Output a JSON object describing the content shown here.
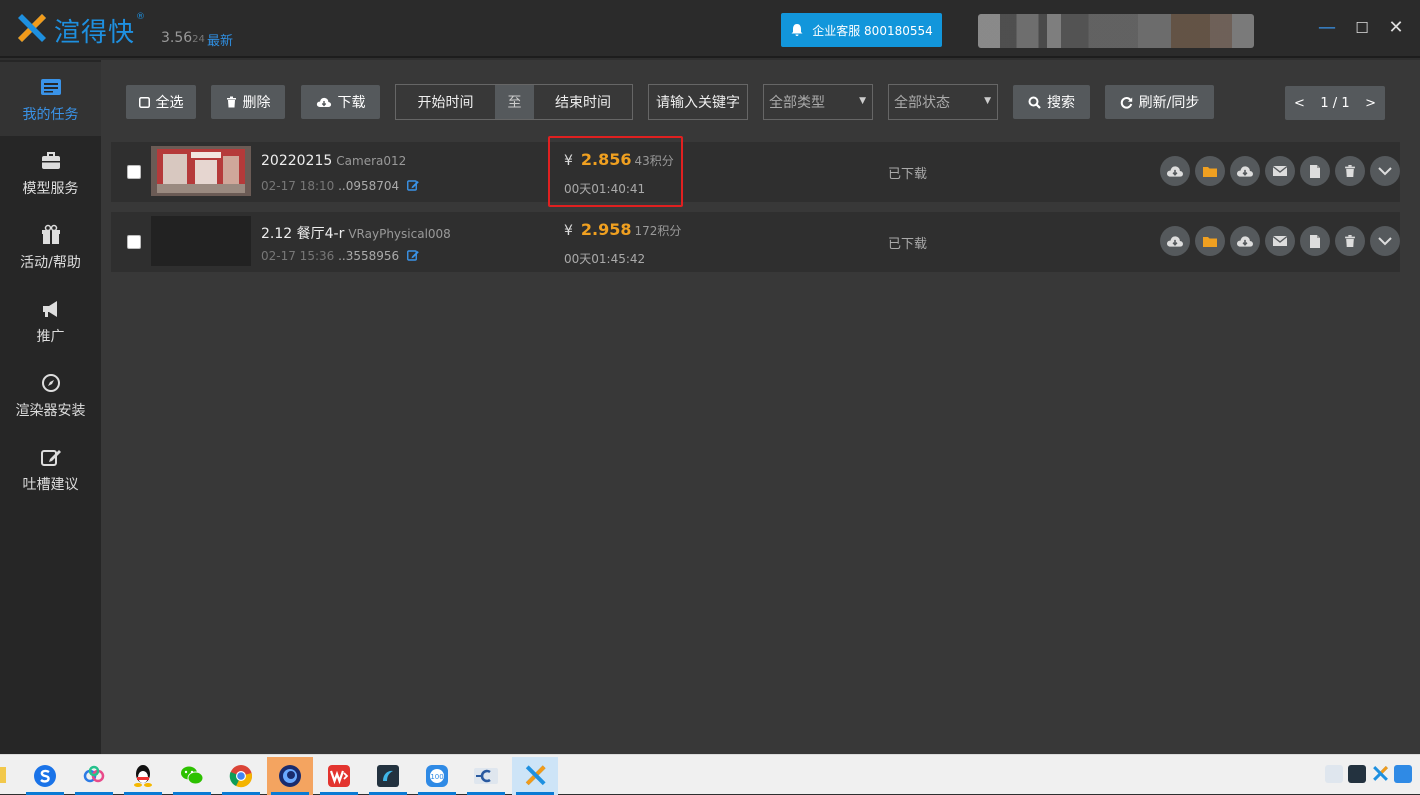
{
  "app": {
    "name": "渲得快",
    "registered": "®",
    "version": "3.56",
    "build": "24",
    "latest": "最新",
    "support_button": "企业客服 800180554",
    "window_minimize": "—",
    "window_maximize": "☐",
    "window_close": "✕"
  },
  "sidebar": {
    "items": [
      {
        "label": "我的任务",
        "icon": "task-list-icon",
        "active": true
      },
      {
        "label": "模型服务",
        "icon": "briefcase-icon"
      },
      {
        "label": "活动/帮助",
        "icon": "gift-icon"
      },
      {
        "label": "推广",
        "icon": "megaphone-icon"
      },
      {
        "label": "渲染器安装",
        "icon": "compass-icon"
      },
      {
        "label": "吐槽建议",
        "icon": "edit-icon"
      }
    ]
  },
  "toolbar": {
    "select_all": "全选",
    "delete": "删除",
    "download": "下载",
    "start_time": "开始时间",
    "to": "至",
    "end_time": "结束时间",
    "keyword_placeholder": "请输入关键字",
    "type_select": "全部类型",
    "status_select": "全部状态",
    "search": "搜索",
    "refresh": "刷新/同步",
    "pager": {
      "prev": "<",
      "page": "1 / 1",
      "next": ">"
    }
  },
  "tasks": [
    {
      "name": "20220215",
      "camera": "Camera012",
      "date": "02-17 18:10",
      "id": "..0958704",
      "yen": "¥",
      "price": "2.856",
      "points": "43积分",
      "duration": "00天01:40:41",
      "status": "已下载"
    },
    {
      "name": "2.12 餐厅4-r",
      "camera": "VRayPhysical008",
      "date": "02-17 15:36",
      "id": "..3558956",
      "yen": "¥",
      "price": "2.958",
      "points": "172积分",
      "duration": "00天01:45:42",
      "status": "已下载"
    }
  ],
  "row_actions": [
    "cloud-download-icon",
    "folder-icon",
    "cloud-download-icon",
    "envelope-icon",
    "file-icon",
    "trash-icon",
    "chevron-down-icon"
  ],
  "colors": {
    "accent": "#1296db",
    "price": "#f0a020",
    "highlight": "#e02020"
  },
  "taskbar": {
    "apps": [
      "sogou-icon",
      "baidu-netdisk-icon",
      "qq-icon",
      "wechat-icon",
      "chrome-icon",
      "cinema4d-icon",
      "wps-icon",
      "renderbus-icon",
      "360-icon",
      "c-app-icon",
      "xuandekuai-icon"
    ]
  }
}
